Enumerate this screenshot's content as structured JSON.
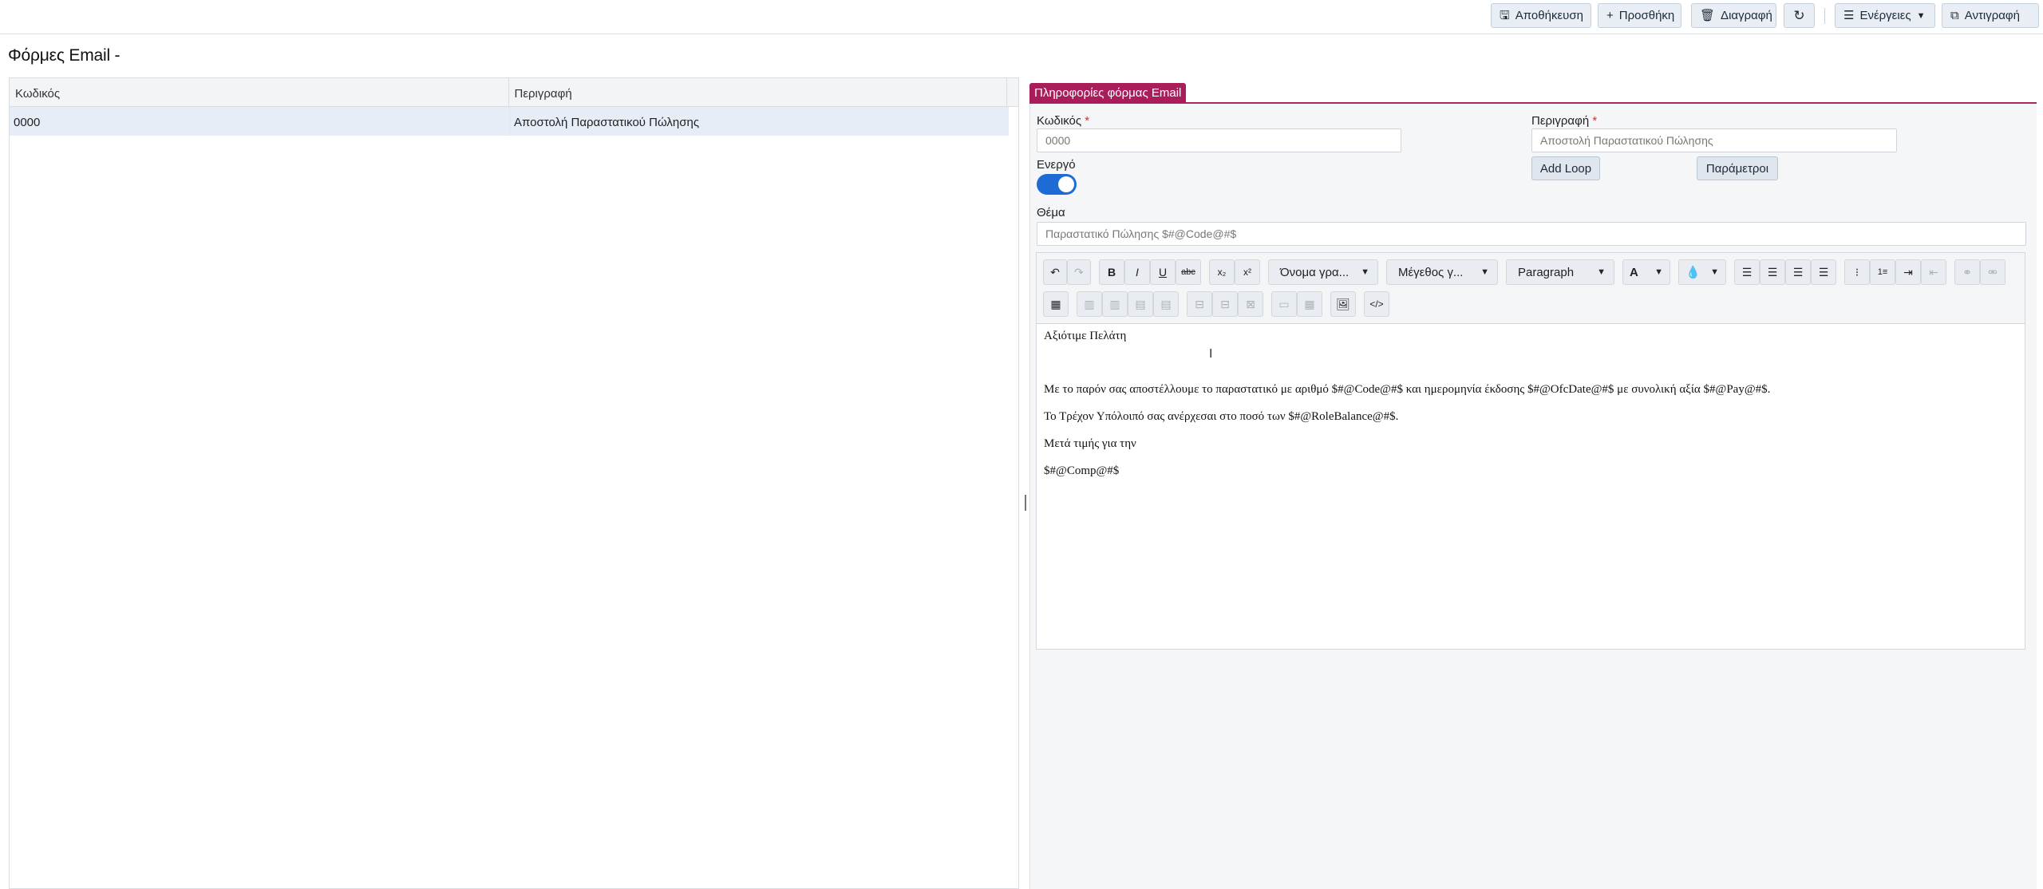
{
  "toolbar": {
    "save": "Αποθήκευση",
    "add": "Προσθήκη",
    "delete": "Διαγραφή",
    "actions": "Ενέργειες",
    "copy": "Αντιγραφή"
  },
  "page": {
    "title": "Φόρμες Email -"
  },
  "grid": {
    "headers": [
      "Κωδικός",
      "Περιγραφή"
    ],
    "rows": [
      {
        "code": "0000",
        "description": "Αποστολή Παραστατικού Πώλησης"
      }
    ]
  },
  "panel": {
    "tab": "Πληροφορίες φόρμας Email",
    "code_label": "Κωδικός",
    "code_value": "0000",
    "description_label": "Περιγραφή",
    "description_value": "Αποστολή Παραστατικού Πώλησης",
    "required_mark": "*",
    "active_label": "Ενεργό",
    "active": true,
    "add_loop": "Add Loop",
    "parameters": "Παράμετροι",
    "subject_label": "Θέμα",
    "subject_value": "Παραστατικό Πώλησης $#@Code@#$"
  },
  "editor": {
    "font_name": "Όνομα γρα...",
    "font_size": "Μέγεθος γ...",
    "block": "Paragraph",
    "font_color": "A",
    "lines": [
      "Αξιότιμε Πελάτη",
      "Με το παρόν σας αποστέλλουμε το παραστατικό με αριθμό $#@Code@#$ και ημερομηνία έκδοσης $#@OfcDate@#$ με συνολική αξία $#@Pay@#$.",
      "Το Τρέχον Υπόλοιπό σας ανέρχεσαι στο ποσό των $#@RoleBalance@#$.",
      "Μετά τιμής για την",
      "$#@Comp@#$"
    ]
  },
  "icons": {
    "save": "floppy-icon",
    "add": "plus-icon",
    "delete": "trash-icon",
    "refresh": "refresh-icon",
    "actions": "menu-icon",
    "copy": "copy-icon"
  },
  "colors": {
    "accent": "#a91e5a",
    "toggle": "#1e6bd6",
    "selected_row": "#e6edf7"
  }
}
